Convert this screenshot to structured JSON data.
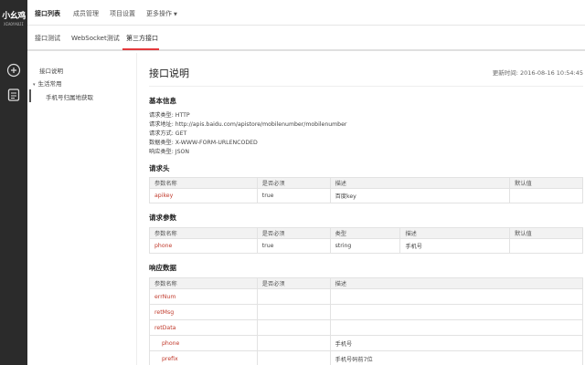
{
  "logo": {
    "text": "小幺鸡",
    "subtitle": "XIAOYAOJI"
  },
  "rail": {
    "icons": [
      "plus-circle-icon",
      "document-icon"
    ]
  },
  "topnav": {
    "items": [
      {
        "label": "接口列表",
        "active": true
      },
      {
        "label": "成员管理",
        "active": false
      },
      {
        "label": "项目设置",
        "active": false
      },
      {
        "label": "更多操作",
        "active": false,
        "has_dropdown": true
      }
    ]
  },
  "subnav": {
    "tabs": [
      {
        "label": "接口测试",
        "active": false
      },
      {
        "label": "WebSocket测试",
        "active": false
      },
      {
        "label": "第三方接口",
        "active": true
      }
    ],
    "accent": "#e4393c"
  },
  "sidebar": {
    "items": [
      {
        "label": "接口说明"
      },
      {
        "label": "生活常用",
        "expanded": true
      },
      {
        "label": "手机号归属地获取",
        "selected": true
      }
    ]
  },
  "page": {
    "title": "接口说明",
    "updated": "更新时间: 2016-08-16 10:54:45"
  },
  "basic": {
    "heading": "基本信息",
    "lines": [
      "请求类型: HTTP",
      "请求地址: http://apis.baidu.com/apistore/mobilenumber/mobilenumber",
      "请求方式: GET",
      "数据类型: X-WWW-FORM-URLENCODED",
      "响应类型: JSON"
    ]
  },
  "headers": {
    "heading": "请求头",
    "columns": [
      "参数名称",
      "是否必须",
      "描述",
      "默认值"
    ],
    "rows": [
      {
        "name": "apikey",
        "required": "true",
        "desc": "百度key",
        "default": ""
      }
    ]
  },
  "params": {
    "heading": "请求参数",
    "columns": [
      "参数名称",
      "是否必须",
      "类型",
      "描述",
      "默认值"
    ],
    "rows": [
      {
        "name": "phone",
        "required": "true",
        "type": "string",
        "desc": "手机号",
        "default": ""
      }
    ]
  },
  "response": {
    "heading": "响应数据",
    "columns": [
      "参数名称",
      "是否必须",
      "描述"
    ],
    "rows": [
      {
        "name": "errNum",
        "required": "",
        "desc": "",
        "nested": false
      },
      {
        "name": "retMsg",
        "required": "",
        "desc": "",
        "nested": false
      },
      {
        "name": "retData",
        "required": "",
        "desc": "",
        "nested": false
      },
      {
        "name": "phone",
        "required": "",
        "desc": "手机号",
        "nested": true
      },
      {
        "name": "prefix",
        "required": "",
        "desc": "手机号码前7位",
        "nested": true
      }
    ]
  },
  "colors": {
    "rail": "#2b2b2b",
    "param_name": "#c0392b",
    "table_header": "#f2f2f2"
  }
}
